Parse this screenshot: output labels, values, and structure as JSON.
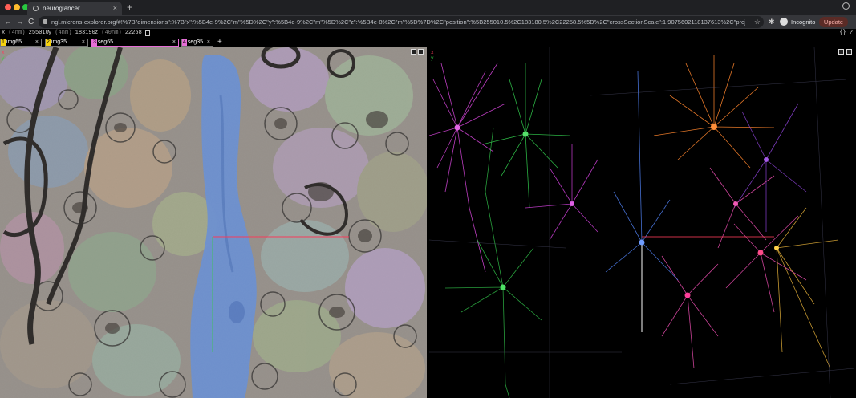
{
  "browser": {
    "tab_title": "neuroglancer",
    "tab_close": "×",
    "new_tab": "+",
    "nav": {
      "back": "←",
      "forward": "→",
      "reload": "C"
    },
    "url": "ngl.microns-explorer.org/#!%7B\"dimensions\":%7B\"x\":%5B4e-9%2C\"m\"%5D%2C\"y\":%5B4e-9%2C\"m\"%5D%2C\"z\":%5B4e-8%2C\"m\"%5D%7D%2C\"position\":%5B255010.5%2C183180.5%2C22258.5%5D%2C\"crossSectionScale\":1.9075602118137613%2C\"projectionOr...",
    "incognito_label": "Incognito",
    "update_label": "Update",
    "menu": "⋮"
  },
  "coords": {
    "x": {
      "label": "x",
      "unit": "4nm",
      "value": "255010"
    },
    "y": {
      "label": "y",
      "unit": "4nm",
      "value": "183190"
    },
    "z": {
      "label": "z",
      "unit": "40nm",
      "value": "22258"
    },
    "help": "{} ?"
  },
  "layers": [
    {
      "index": "1",
      "name": "img65",
      "color": "#f6d20e"
    },
    {
      "index": "2",
      "name": "img35",
      "color": "#f6d20e"
    },
    {
      "index": "3",
      "name": "seg65",
      "color": "#e66dd6"
    },
    {
      "index": "4",
      "name": "seg35",
      "color": "#e66dd6"
    }
  ],
  "layer_close": "×",
  "add_layer": "+",
  "axes": {
    "x": "x",
    "y": "y"
  },
  "colors": {
    "crosshair_red": "#ff3b5c",
    "crosshair_green": "#37d14a",
    "vessel_blue": "#6f94d6"
  },
  "icons": [
    "browser-tab-favicon",
    "lock-icon",
    "star-icon",
    "extension-icon",
    "incognito-icon",
    "copy-icon",
    "panel-expand-icon",
    "panel-layout-icon"
  ]
}
